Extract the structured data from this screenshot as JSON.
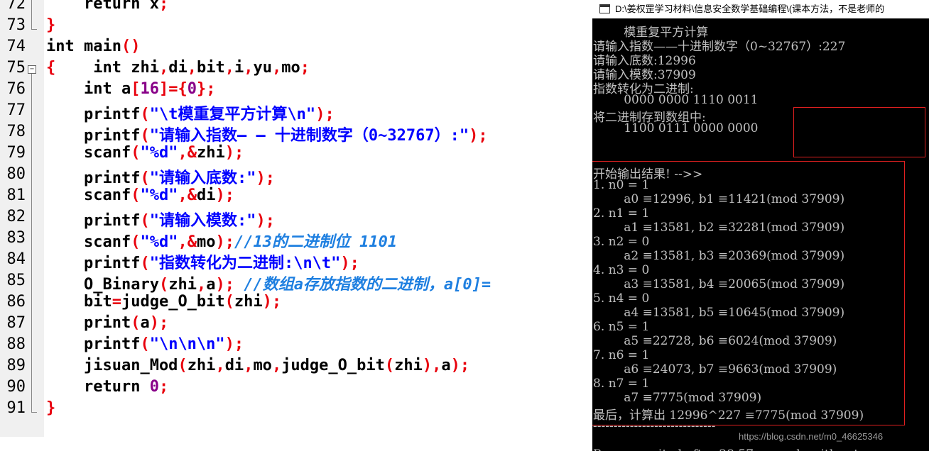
{
  "editor": {
    "lines": [
      {
        "num": "72",
        "fold": "line",
        "code": [
          [
            "kw",
            "    return x"
          ],
          [
            "op",
            ";"
          ]
        ]
      },
      {
        "num": "73",
        "fold": "end",
        "code": [
          [
            "br",
            "}"
          ]
        ]
      },
      {
        "num": "74",
        "fold": "",
        "code": [
          [
            "kw",
            "int main"
          ],
          [
            "br",
            "()"
          ]
        ]
      },
      {
        "num": "75",
        "fold": "box",
        "code": [
          [
            "br",
            "{"
          ],
          [
            "kw",
            "    int zhi"
          ],
          [
            "op",
            ","
          ],
          [
            "kw",
            "di"
          ],
          [
            "op",
            ","
          ],
          [
            "kw",
            "bit"
          ],
          [
            "op",
            ","
          ],
          [
            "kw",
            "i"
          ],
          [
            "op",
            ","
          ],
          [
            "kw",
            "yu"
          ],
          [
            "op",
            ","
          ],
          [
            "kw",
            "mo"
          ],
          [
            "op",
            ";"
          ]
        ]
      },
      {
        "num": "76",
        "fold": "line",
        "code": [
          [
            "kw",
            "    int a"
          ],
          [
            "br",
            "["
          ],
          [
            "num",
            "16"
          ],
          [
            "br",
            "]"
          ],
          [
            "op",
            "="
          ],
          [
            "br",
            "{"
          ],
          [
            "num",
            "0"
          ],
          [
            "br",
            "}"
          ],
          [
            "op",
            ";"
          ]
        ]
      },
      {
        "num": "77",
        "fold": "line",
        "code": [
          [
            "kw",
            "    printf"
          ],
          [
            "br",
            "("
          ],
          [
            "str",
            "\"\\t模重复平方计算\\n\""
          ],
          [
            "br",
            ")"
          ],
          [
            "op",
            ";"
          ]
        ]
      },
      {
        "num": "78",
        "fold": "line",
        "code": [
          [
            "kw",
            "    printf"
          ],
          [
            "br",
            "("
          ],
          [
            "str",
            "\"请输入指数— — 十进制数字（0~32767）:\""
          ],
          [
            "br",
            ")"
          ],
          [
            "op",
            ";"
          ]
        ]
      },
      {
        "num": "79",
        "fold": "line",
        "code": [
          [
            "kw",
            "    scanf"
          ],
          [
            "br",
            "("
          ],
          [
            "str",
            "\"%d\""
          ],
          [
            "op",
            ",&"
          ],
          [
            "kw",
            "zhi"
          ],
          [
            "br",
            ")"
          ],
          [
            "op",
            ";"
          ]
        ]
      },
      {
        "num": "80",
        "fold": "line",
        "code": [
          [
            "kw",
            "    printf"
          ],
          [
            "br",
            "("
          ],
          [
            "str",
            "\"请输入底数:\""
          ],
          [
            "br",
            ")"
          ],
          [
            "op",
            ";"
          ]
        ]
      },
      {
        "num": "81",
        "fold": "line",
        "code": [
          [
            "kw",
            "    scanf"
          ],
          [
            "br",
            "("
          ],
          [
            "str",
            "\"%d\""
          ],
          [
            "op",
            ",&"
          ],
          [
            "kw",
            "di"
          ],
          [
            "br",
            ")"
          ],
          [
            "op",
            ";"
          ]
        ]
      },
      {
        "num": "82",
        "fold": "line",
        "code": [
          [
            "kw",
            "    printf"
          ],
          [
            "br",
            "("
          ],
          [
            "str",
            "\"请输入模数:\""
          ],
          [
            "br",
            ")"
          ],
          [
            "op",
            ";"
          ]
        ]
      },
      {
        "num": "83",
        "fold": "line",
        "code": [
          [
            "kw",
            "    scanf"
          ],
          [
            "br",
            "("
          ],
          [
            "str",
            "\"%d\""
          ],
          [
            "op",
            ",&"
          ],
          [
            "kw",
            "mo"
          ],
          [
            "br",
            ")"
          ],
          [
            "op",
            ";"
          ],
          [
            "cm",
            "//13的二进制位 1101"
          ]
        ]
      },
      {
        "num": "84",
        "fold": "line",
        "code": [
          [
            "kw",
            "    printf"
          ],
          [
            "br",
            "("
          ],
          [
            "str",
            "\"指数转化为二进制:\\n\\t\""
          ],
          [
            "br",
            ")"
          ],
          [
            "op",
            ";"
          ]
        ]
      },
      {
        "num": "85",
        "fold": "line",
        "code": [
          [
            "kw",
            "    O_Binary"
          ],
          [
            "br",
            "("
          ],
          [
            "kw",
            "zhi"
          ],
          [
            "op",
            ","
          ],
          [
            "kw",
            "a"
          ],
          [
            "br",
            ")"
          ],
          [
            "op",
            ";"
          ],
          [
            "cm",
            " //数组a存放指数的二进制，a[0]="
          ]
        ]
      },
      {
        "num": "86",
        "fold": "line",
        "code": [
          [
            "kw",
            "    bit"
          ],
          [
            "op",
            "="
          ],
          [
            "kw",
            "judge_O_bit"
          ],
          [
            "br",
            "("
          ],
          [
            "kw",
            "zhi"
          ],
          [
            "br",
            ")"
          ],
          [
            "op",
            ";"
          ]
        ]
      },
      {
        "num": "87",
        "fold": "line",
        "code": [
          [
            "kw",
            "    print"
          ],
          [
            "br",
            "("
          ],
          [
            "kw",
            "a"
          ],
          [
            "br",
            ")"
          ],
          [
            "op",
            ";"
          ]
        ]
      },
      {
        "num": "88",
        "fold": "line",
        "code": [
          [
            "kw",
            "    printf"
          ],
          [
            "br",
            "("
          ],
          [
            "str",
            "\"\\n\\n\\n\""
          ],
          [
            "br",
            ")"
          ],
          [
            "op",
            ";"
          ]
        ]
      },
      {
        "num": "89",
        "fold": "line",
        "code": [
          [
            "kw",
            "    jisuan_Mod"
          ],
          [
            "br",
            "("
          ],
          [
            "kw",
            "zhi"
          ],
          [
            "op",
            ","
          ],
          [
            "kw",
            "di"
          ],
          [
            "op",
            ","
          ],
          [
            "kw",
            "mo"
          ],
          [
            "op",
            ","
          ],
          [
            "kw",
            "judge_O_bit"
          ],
          [
            "br",
            "("
          ],
          [
            "kw",
            "zhi"
          ],
          [
            "br",
            "),"
          ],
          [
            "kw",
            "a"
          ],
          [
            "br",
            ")"
          ],
          [
            "op",
            ";"
          ]
        ]
      },
      {
        "num": "90",
        "fold": "line",
        "code": [
          [
            "kw",
            "    return "
          ],
          [
            "num",
            "0"
          ],
          [
            "op",
            ";"
          ]
        ]
      },
      {
        "num": "91",
        "fold": "end",
        "code": [
          [
            "br",
            "}"
          ]
        ]
      }
    ]
  },
  "console": {
    "title": "D:\\姜权罡学习材料\\信息安全数学基础编程\\(课本方法，不是老师的",
    "lines": [
      "        模重复平方计算",
      "请输入指数——十进制数字（0~32767）:227",
      "请输入底数:12996",
      "请输入模数:37909",
      "指数转化为二进制:",
      "        0000 0000 1110 0011",
      "将二进制存到数组中:",
      "        1100 0111 0000 0000",
      "",
      "",
      "开始输出结果! -->>",
      "1. n0 = 1",
      "        a0 ≡12996, b1 ≡11421(mod 37909)",
      "2. n1 = 1",
      "        a1 ≡13581, b2 ≡32281(mod 37909)",
      "3. n2 = 0",
      "        a2 ≡13581, b3 ≡20369(mod 37909)",
      "4. n3 = 0",
      "        a3 ≡13581, b4 ≡20065(mod 37909)",
      "5. n4 = 0",
      "        a4 ≡13581, b5 ≡10645(mod 37909)",
      "6. n5 = 1",
      "        a5 ≡22728, b6 ≡6024(mod 37909)",
      "7. n6 = 1",
      "        a6 ≡24073, b7 ≡9663(mod 37909)",
      "8. n7 = 1",
      "        a7 ≡7775(mod 37909)",
      "最后，计算出 12996^227 ≡7775(mod 37909)",
      "------------------------------",
      "",
      "Process exited after 28.57 seconds with return v"
    ],
    "watermark": "https://blog.csdn.net/m0_46625346"
  }
}
